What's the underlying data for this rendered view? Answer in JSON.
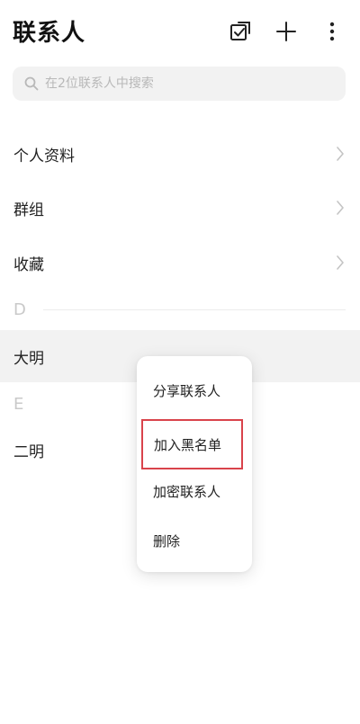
{
  "header": {
    "title": "联系人",
    "icons": {
      "multi_select": "checkbox-edit-icon",
      "add": "plus-icon",
      "more": "more-vertical-icon"
    }
  },
  "search": {
    "placeholder": "在2位联系人中搜索",
    "icon": "search-icon"
  },
  "nav_items": [
    {
      "label": "个人资料"
    },
    {
      "label": "群组"
    },
    {
      "label": "收藏"
    }
  ],
  "sections": [
    {
      "letter": "D",
      "contacts": [
        {
          "name": "大明"
        }
      ]
    },
    {
      "letter": "E",
      "contacts": [
        {
          "name": "二明"
        }
      ]
    }
  ],
  "context_menu": {
    "items": [
      {
        "label": "分享联系人"
      },
      {
        "label": "加入黑名单",
        "highlight": true
      },
      {
        "label": "加密联系人"
      },
      {
        "label": "删除"
      }
    ]
  },
  "colors": {
    "highlight_border": "#d9434b",
    "row_highlight": "#f2f2f2",
    "section_letter": "#c9c9c9"
  }
}
